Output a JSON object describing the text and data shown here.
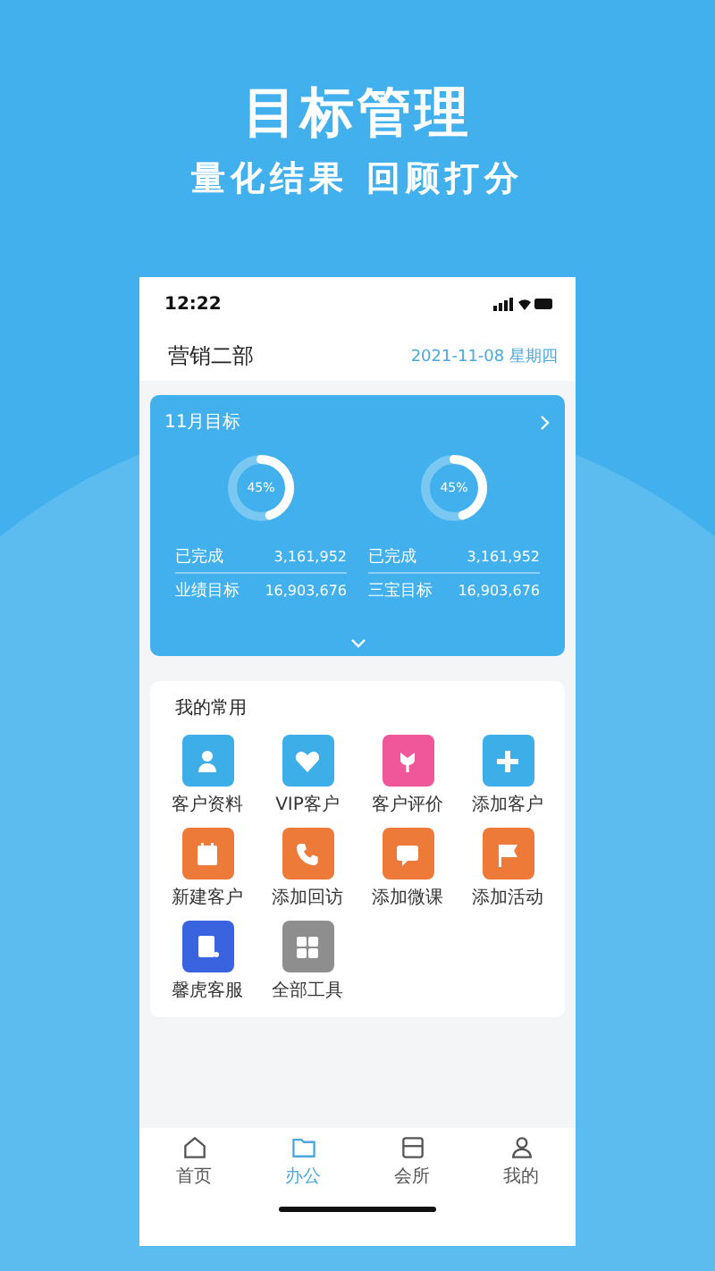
{
  "hero": {
    "title": "目标管理",
    "subtitle": "量化结果 回顾打分"
  },
  "status_bar": {
    "time": "12:22"
  },
  "header": {
    "title": "营销二部",
    "date": "2021-11-08 星期四"
  },
  "goal_card": {
    "title": "11月目标",
    "goals": [
      {
        "percent": "45%",
        "level": 0.45,
        "rows": [
          {
            "label": "已完成",
            "value": "3,161,952"
          },
          {
            "label": "业绩目标",
            "value": "16,903,676"
          }
        ]
      },
      {
        "percent": "45%",
        "level": 0.45,
        "rows": [
          {
            "label": "已完成",
            "value": "3,161,952"
          },
          {
            "label": "三宝目标",
            "value": "16,903,676"
          }
        ]
      }
    ]
  },
  "favorites": {
    "title": "我的常用",
    "items": [
      {
        "label": "客户资料",
        "color": "#3eaee9"
      },
      {
        "label": "VIP客户",
        "color": "#3eaee9"
      },
      {
        "label": "客户评价",
        "color": "#f0569a"
      },
      {
        "label": "添加客户",
        "color": "#3eaee9"
      },
      {
        "label": "新建客户",
        "color": "#ee7a3a"
      },
      {
        "label": "添加回访",
        "color": "#ee7a3a"
      },
      {
        "label": "添加微课",
        "color": "#ee7a3a"
      },
      {
        "label": "添加活动",
        "color": "#ee7a3a"
      },
      {
        "label": "馨虎客服",
        "color": "#3a63e0"
      },
      {
        "label": "全部工具",
        "color": "#8e8e8e"
      }
    ]
  },
  "tab_bar": [
    {
      "label": "首页",
      "selected": false
    },
    {
      "label": "办公",
      "selected": true
    },
    {
      "label": "会所",
      "selected": false
    },
    {
      "label": "我的",
      "selected": false
    }
  ]
}
